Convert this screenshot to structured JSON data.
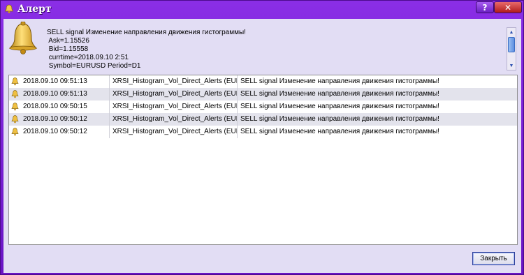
{
  "window": {
    "title": "Алерт"
  },
  "titlebar": {
    "help_label": "?",
    "close_label": "✕"
  },
  "message": {
    "lines": [
      "SELL signal Изменение направления движения гистограммы!",
      " Ask=1.15526",
      " Bid=1.15558",
      " currtime=2018.09.10 2:51",
      " Symbol=EURUSD Period=D1"
    ]
  },
  "alerts": [
    {
      "time": "2018.09.10 09:51:13",
      "name": "XRSI_Histogram_Vol_Direct_Alerts (EUR...",
      "message": "SELL signal Изменение направления движения гистограммы!"
    },
    {
      "time": "2018.09.10 09:51:13",
      "name": "XRSI_Histogram_Vol_Direct_Alerts (EUR...",
      "message": "SELL signal Изменение направления движения гистограммы!"
    },
    {
      "time": "2018.09.10 09:50:15",
      "name": "XRSI_Histogram_Vol_Direct_Alerts (EUR...",
      "message": "SELL signal Изменение направления движения гистограммы!"
    },
    {
      "time": "2018.09.10 09:50:12",
      "name": "XRSI_Histogram_Vol_Direct_Alerts (EUR...",
      "message": "SELL signal Изменение направления движения гистограммы!"
    },
    {
      "time": "2018.09.10 09:50:12",
      "name": "XRSI_Histogram_Vol_Direct_Alerts (EUR...",
      "message": "SELL signal Изменение направления движения гистограммы!"
    }
  ],
  "footer": {
    "close_button_label": "Закрыть"
  },
  "icons": {
    "window": "bell-icon",
    "message": "bell-icon",
    "row": "bell-icon"
  },
  "colors": {
    "titlebar": "#7a1fd0",
    "client": "#e2ddf4",
    "alt_row": "#e3e3ec",
    "close_red": "#c0282b"
  }
}
